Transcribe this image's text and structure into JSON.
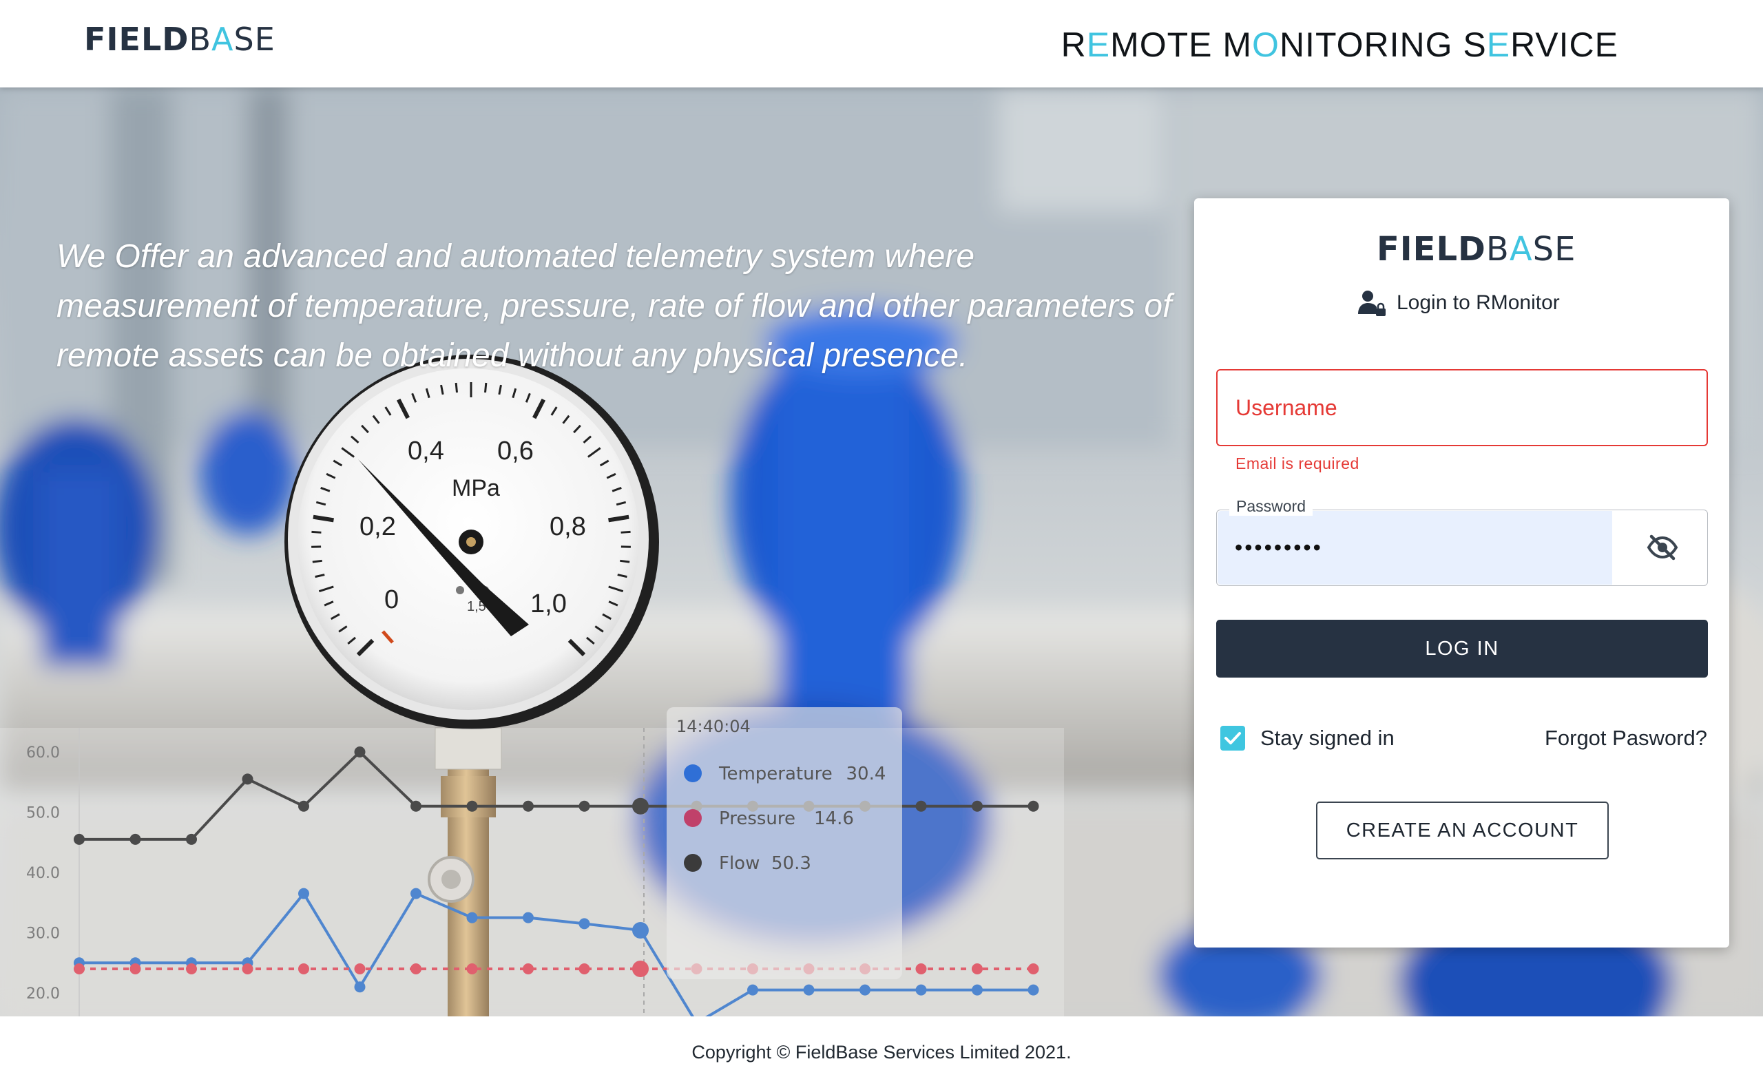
{
  "header": {
    "logo": {
      "field": "FIELD",
      "base": "BASE"
    },
    "title_parts": [
      {
        "text": "R",
        "accent": false
      },
      {
        "text": "E",
        "accent": true
      },
      {
        "text": "MOTE ",
        "accent": false
      },
      {
        "text": "M",
        "accent": false
      },
      {
        "text": "O",
        "accent": true
      },
      {
        "text": "NITORING ",
        "accent": false
      },
      {
        "text": "S",
        "accent": false
      },
      {
        "text": "E",
        "accent": true
      },
      {
        "text": "RVICE",
        "accent": false
      }
    ]
  },
  "hero": {
    "tagline": "We Offer an advanced and automated telemetry system where measurement of temperature, pressure, rate of flow and other parameters of remote assets can be obtained without any physical presence.",
    "gauge": {
      "unit": "MPa",
      "ticks": [
        "0",
        "0,2",
        "0,4",
        "0,6",
        "0,8",
        "1,0"
      ],
      "class_mark": "1,5"
    },
    "chart": {
      "y_ticks": [
        "60.0",
        "50.0",
        "40.0",
        "30.0",
        "20.0"
      ],
      "tooltip": {
        "time": "14:40:04",
        "rows": [
          {
            "label": "Temperature",
            "value": "30.4",
            "color": "#2f6fd6"
          },
          {
            "label": "Pressure",
            "value": "14.6",
            "color": "#c0416a"
          },
          {
            "label": "Flow",
            "value": "50.3",
            "color": "#3b3b3b"
          }
        ]
      }
    }
  },
  "login": {
    "logo": {
      "field": "FIELD",
      "base": "BASE"
    },
    "subtitle": "Login to RMonitor",
    "username_placeholder": "Username",
    "username_error": "Email is required",
    "password_label": "Password",
    "password_value": "•••••••••",
    "login_button": "LOG IN",
    "stay_signed_in": "Stay signed in",
    "stay_signed_in_checked": true,
    "forgot_password": "Forgot Pasword?",
    "create_account": "CREATE AN ACCOUNT"
  },
  "footer": {
    "copyright": "Copyright © FieldBase Services Limited 2021."
  },
  "colors": {
    "brand_dark": "#263242",
    "accent": "#40c4e0",
    "error": "#e53935",
    "autofill": "#e8f0fe"
  },
  "chart_data": {
    "type": "line",
    "x": [
      1,
      2,
      3,
      4,
      5,
      6,
      7,
      8,
      9,
      10,
      11,
      12,
      13,
      14,
      15,
      16,
      17,
      18
    ],
    "series": [
      {
        "name": "Temperature",
        "values": [
          25,
          25,
          25,
          25,
          36.5,
          21,
          36.5,
          32.5,
          32.5,
          31.5,
          30.4,
          15,
          20.5,
          20.5,
          20.5,
          20.5,
          20.5,
          20.5
        ]
      },
      {
        "name": "Pressure",
        "values": [
          24,
          24,
          24,
          24,
          24,
          24,
          24,
          24,
          24,
          24,
          24,
          24,
          24,
          24,
          24,
          24,
          24,
          24
        ]
      },
      {
        "name": "Flow",
        "values": [
          45.5,
          45.5,
          45.5,
          55.5,
          51,
          60,
          51,
          51,
          51,
          51,
          51,
          51,
          51,
          51,
          51,
          51,
          51,
          51
        ]
      }
    ],
    "ylim": [
      20,
      60
    ],
    "y_ticks": [
      60,
      50,
      40,
      30,
      20
    ]
  }
}
